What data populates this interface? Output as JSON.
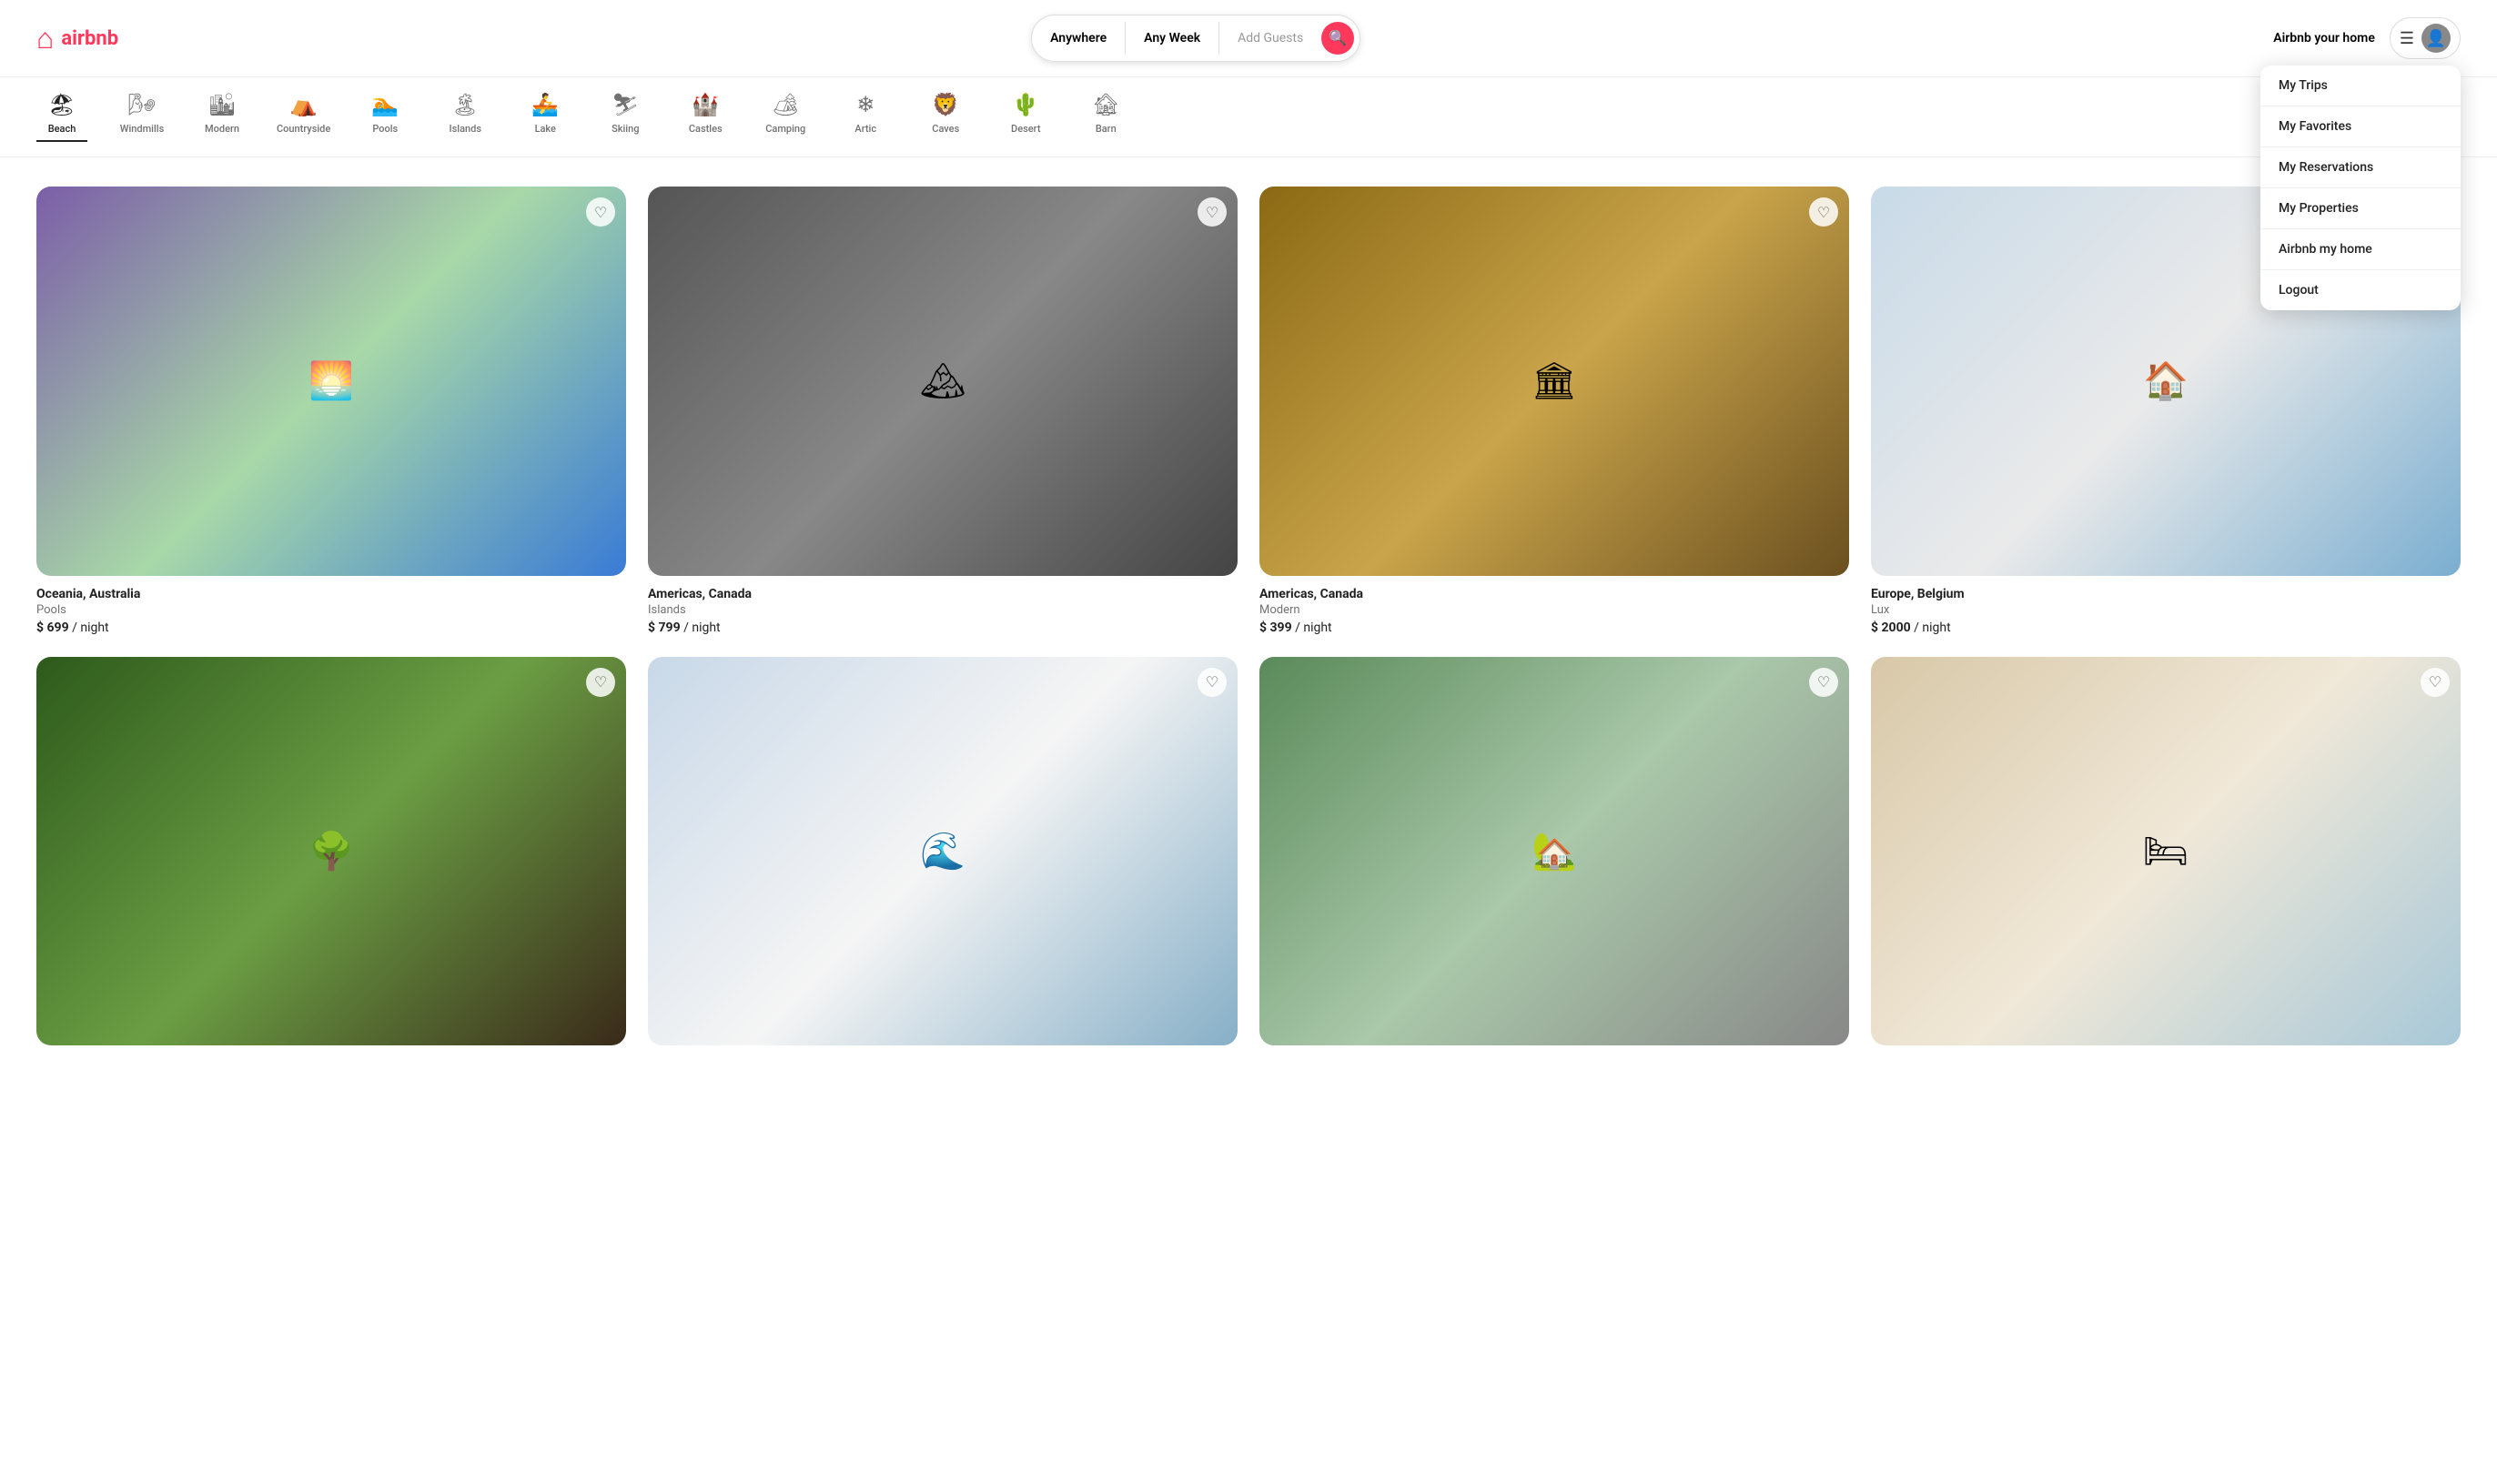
{
  "header": {
    "logo_text": "airbnb",
    "airbnb_home_link": "Airbnb your home"
  },
  "search": {
    "anywhere": "Anywhere",
    "any_week": "Any Week",
    "add_guests": "Add Guests"
  },
  "dropdown": {
    "items": [
      {
        "id": "my-trips",
        "label": "My Trips"
      },
      {
        "id": "my-favorites",
        "label": "My Favorites"
      },
      {
        "id": "my-reservations",
        "label": "My Reservations"
      },
      {
        "id": "my-properties",
        "label": "My Properties"
      },
      {
        "id": "airbnb-my-home",
        "label": "Airbnb my home"
      },
      {
        "id": "logout",
        "label": "Logout"
      }
    ]
  },
  "categories": [
    {
      "id": "beach",
      "label": "Beach",
      "icon": "🏖",
      "active": true
    },
    {
      "id": "windmills",
      "label": "Windmills",
      "icon": "🌬",
      "active": false
    },
    {
      "id": "modern",
      "label": "Modern",
      "icon": "🏙",
      "active": false
    },
    {
      "id": "countryside",
      "label": "Countryside",
      "icon": "⛺",
      "active": false
    },
    {
      "id": "pools",
      "label": "Pools",
      "icon": "🏊",
      "active": false
    },
    {
      "id": "islands",
      "label": "Islands",
      "icon": "🏝",
      "active": false
    },
    {
      "id": "lake",
      "label": "Lake",
      "icon": "🚣",
      "active": false
    },
    {
      "id": "skiing",
      "label": "Skiing",
      "icon": "⛷",
      "active": false
    },
    {
      "id": "castles",
      "label": "Castles",
      "icon": "🏰",
      "active": false
    },
    {
      "id": "camping",
      "label": "Camping",
      "icon": "🏕",
      "active": false
    },
    {
      "id": "artic",
      "label": "Artic",
      "icon": "❄",
      "active": false
    },
    {
      "id": "caves",
      "label": "Caves",
      "icon": "🦁",
      "active": false
    },
    {
      "id": "desert",
      "label": "Desert",
      "icon": "🌵",
      "active": false
    },
    {
      "id": "barn",
      "label": "Barn",
      "icon": "🏚",
      "active": false
    }
  ],
  "listings": [
    {
      "id": "listing-1",
      "location": "Oceania, Australia",
      "type": "Pools",
      "price": "$ 699",
      "per": "/ night",
      "img_class": "img-oceania",
      "img_emoji": "🌅"
    },
    {
      "id": "listing-2",
      "location": "Americas, Canada",
      "type": "Islands",
      "price": "$ 799",
      "per": "/ night",
      "img_class": "img-americas1",
      "img_emoji": "🏔"
    },
    {
      "id": "listing-3",
      "location": "Americas, Canada",
      "type": "Modern",
      "price": "$ 399",
      "per": "/ night",
      "img_class": "img-americas2",
      "img_emoji": "🏛"
    },
    {
      "id": "listing-4",
      "location": "Europe, Belgium",
      "type": "Lux",
      "price": "$ 2000",
      "per": "/ night",
      "img_class": "img-europe",
      "img_emoji": "🏠"
    },
    {
      "id": "listing-5",
      "location": "",
      "type": "",
      "price": "",
      "per": "",
      "img_class": "img-tree",
      "img_emoji": "🌳"
    },
    {
      "id": "listing-6",
      "location": "",
      "type": "",
      "price": "",
      "per": "",
      "img_class": "img-white",
      "img_emoji": "🌊"
    },
    {
      "id": "listing-7",
      "location": "",
      "type": "",
      "price": "",
      "per": "",
      "img_class": "img-aerial",
      "img_emoji": "🏡"
    },
    {
      "id": "listing-8",
      "location": "",
      "type": "",
      "price": "",
      "per": "",
      "img_class": "img-interior",
      "img_emoji": "🛏"
    }
  ]
}
